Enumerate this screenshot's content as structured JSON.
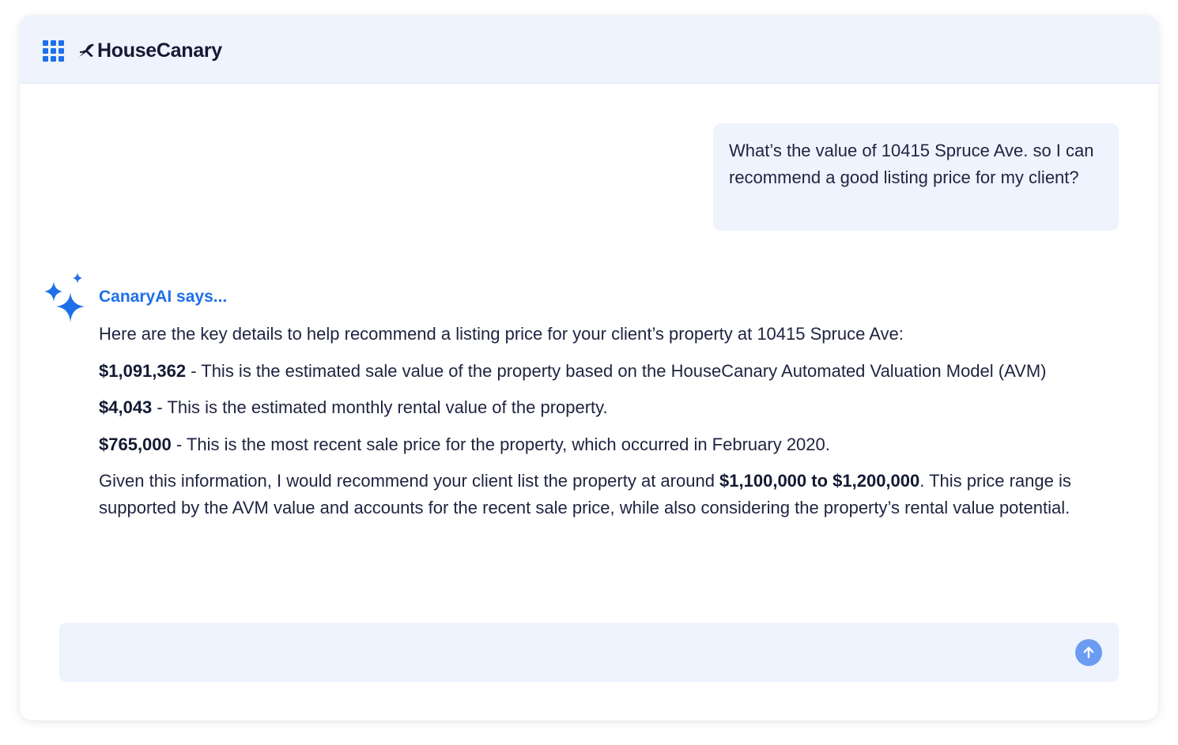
{
  "header": {
    "app_grid_icon": "grid-icon",
    "logo_mark_icon": "canary-bird-icon",
    "brand": "HouseCanary"
  },
  "conversation": {
    "user_message": "What’s the value of 10415 Spruce Ave. so I can recommend a good listing price for my client?",
    "assistant_icon": "sparkle-icon",
    "assistant_label": "CanaryAI says...",
    "assistant_intro": "Here are the key details to help recommend a listing price for your client’s property at 10415 Spruce Ave:",
    "facts": [
      {
        "value": "$1,091,362",
        "text": " - This is the estimated sale value of the property based on the HouseCanary Automated Valuation Model (AVM)"
      },
      {
        "value": "$4,043",
        "text": " - This is the estimated monthly rental value of the property."
      },
      {
        "value": "$765,000",
        "text": " - This is the most recent sale price for the property, which occurred in February 2020."
      }
    ],
    "recommendation": {
      "before": "Given this information, I would recommend your client list the property at around ",
      "range": "$1,100,000 to $1,200,000",
      "after": ". This price range is supported by the AVM value and accounts for the recent sale price, while also considering the property’s rental value potential."
    }
  },
  "composer": {
    "value": "",
    "placeholder": "",
    "send_icon": "arrow-up-icon"
  },
  "colors": {
    "accent": "#1f6fe8",
    "header_bg": "#eef3fd",
    "bubble_bg": "#eef3fd",
    "send_button": "#6c9cf2",
    "text": "#1f2340"
  }
}
